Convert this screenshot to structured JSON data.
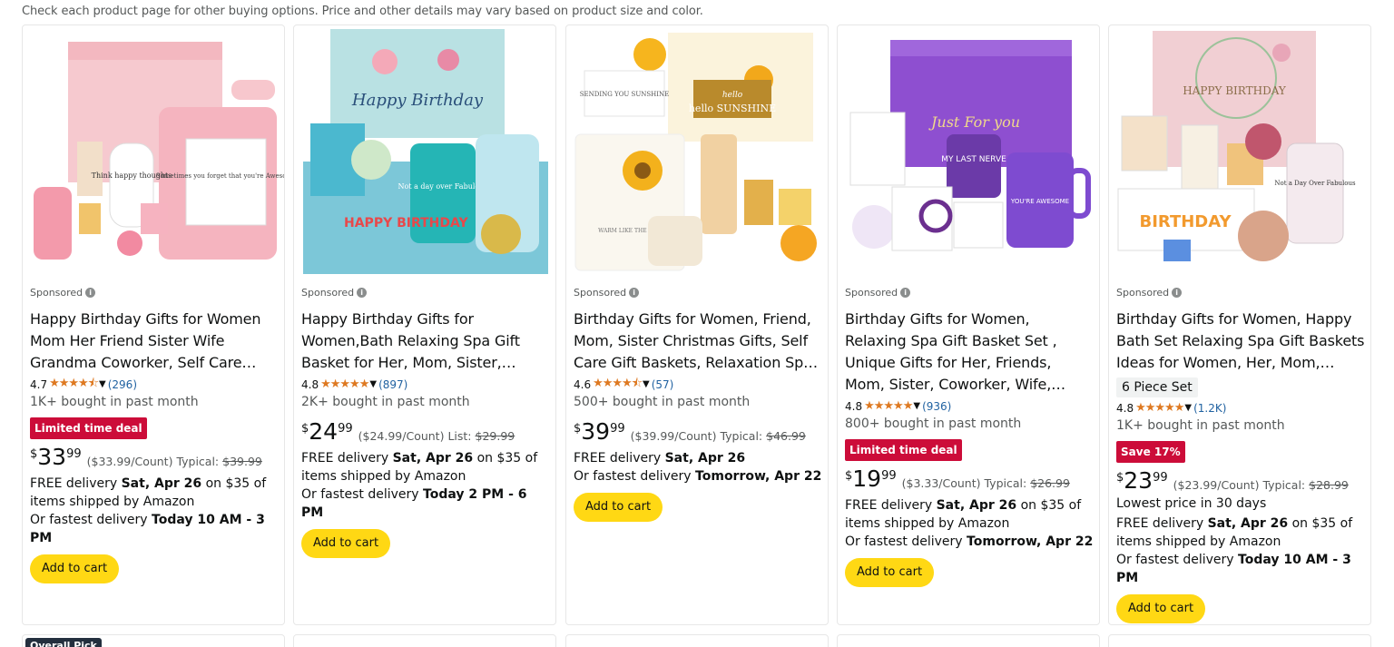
{
  "notice": "Check each product page for other buying options. Price and other details may vary based on product size and color.",
  "sponsored_label": "Sponsored",
  "cart_label": "Add to cart",
  "overall_pick_label": "Overall Pick",
  "colors": {
    "star": "#de7921",
    "deal_badge": "#cc0c39",
    "cart_button": "#ffd814",
    "link": "#2162a1"
  },
  "products": [
    {
      "image_text": [
        "Sometimes you forget that you're Awesome",
        "Think happy thoughts"
      ],
      "title": "Happy Birthday Gifts for Women Mom Her Friend Sister Wife Grandma Coworker, Self Care Gifts Get Well…",
      "rating": "4.7",
      "stars": "★★★★⯪",
      "reviews": "(296)",
      "bought": "1K+ bought in past month",
      "badge": "Limited time deal",
      "price_whole": "33",
      "price_frac": "99",
      "unit": "($33.99/Count) Typical:",
      "was": "$39.99",
      "delivery_pre": "FREE delivery ",
      "delivery_date": "Sat, Apr 26",
      "delivery_post": " on $35 of items shipped by Amazon",
      "fast_pre": "Or fastest delivery ",
      "fast_date": "Today 10 AM - 3 PM"
    },
    {
      "image_text": [
        "Happy Birthday",
        "HAPPY BIRTHDAY",
        "Not a day over Fabulous"
      ],
      "title": "Happy Birthday Gifts for Women,Bath Relaxing Spa Gift Basket for Her, Mom, Sister, Female…",
      "rating": "4.8",
      "stars": "★★★★★",
      "reviews": "(897)",
      "bought": "2K+ bought in past month",
      "price_whole": "24",
      "price_frac": "99",
      "unit": "($24.99/Count) List:",
      "was": "$29.99",
      "delivery_pre": "FREE delivery ",
      "delivery_date": "Sat, Apr 26",
      "delivery_post": " on $35 of items shipped by Amazon",
      "fast_pre": "Or fastest delivery ",
      "fast_date": "Today 2 PM - 6 PM"
    },
    {
      "image_text": [
        "SENDING YOU SUNSHINE",
        "hello SUNSHINE",
        "WARM LIKE THE SUN"
      ],
      "title": "Birthday Gifts for Women, Friend, Mom, Sister Christmas Gifts, Self Care Gift Baskets, Relaxation Spa Gifts S…",
      "rating": "4.6",
      "stars": "★★★★⯪",
      "reviews": "(57)",
      "bought": "500+ bought in past month",
      "price_whole": "39",
      "price_frac": "99",
      "unit": "($39.99/Count) Typical:",
      "was": "$46.99",
      "delivery_pre": "FREE delivery ",
      "delivery_date": "Sat, Apr 26",
      "delivery_post": "",
      "fast_pre": "Or fastest delivery ",
      "fast_date": "Tomorrow, Apr 22"
    },
    {
      "image_text": [
        "Just For you",
        "MY LAST NERVE",
        "YOU'RE AWESOME"
      ],
      "title": "Birthday Gifts for Women, Relaxing Spa Gift Basket Set , Unique Gifts for Her, Friends, Mom, Sister, Coworker, Wife, Girlfriend, Happy Birthday Gif…",
      "rating": "4.8",
      "stars": "★★★★★",
      "reviews": "(936)",
      "bought": "800+ bought in past month",
      "badge": "Limited time deal",
      "price_whole": "19",
      "price_frac": "99",
      "unit": "($3.33/Count) Typical:",
      "was": "$26.99",
      "delivery_pre": "FREE delivery ",
      "delivery_date": "Sat, Apr 26",
      "delivery_post": " on $35 of items shipped by Amazon",
      "fast_pre": "Or fastest delivery ",
      "fast_date": "Tomorrow, Apr 22"
    },
    {
      "image_text": [
        "HAPPY BIRTHDAY",
        "Not a Day Over Fabulous"
      ],
      "title": "Birthday Gifts for Women, Happy Bath Set Relaxing Spa Gift Baskets Ideas for Women, Her, Mom, Sister,…",
      "variant": "6 Piece Set",
      "rating": "4.8",
      "stars": "★★★★★",
      "reviews": "(1.2K)",
      "bought": "1K+ bought in past month",
      "badge": "Save 17%",
      "price_whole": "23",
      "price_frac": "99",
      "unit": "($23.99/Count) Typical:",
      "was": "$28.99",
      "lowest": "Lowest price in 30 days",
      "delivery_pre": "FREE delivery ",
      "delivery_date": "Sat, Apr 26",
      "delivery_post": " on $35 of items shipped by Amazon",
      "fast_pre": "Or fastest delivery ",
      "fast_date": "Today 10 AM - 3 PM"
    }
  ]
}
